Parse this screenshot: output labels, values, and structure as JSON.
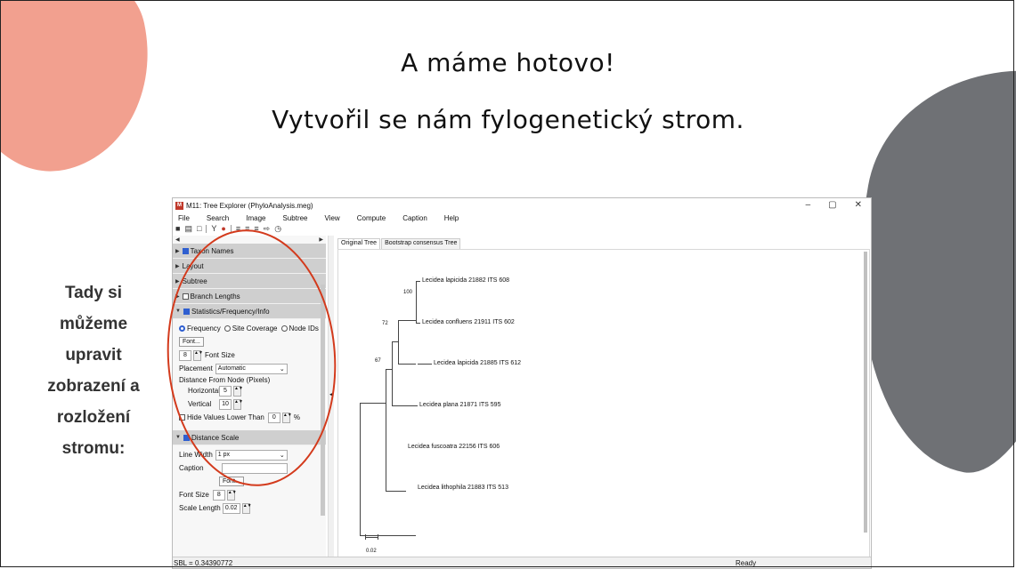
{
  "slide": {
    "title_line1": "A máme hotovo!",
    "title_line2": "Vytvořil se nám fylogenetický strom.",
    "side_lines": [
      "Tady si",
      "můžeme",
      "upravit",
      "zobrazení a",
      "rozložení",
      "stromu:"
    ]
  },
  "window": {
    "title": "M11: Tree Explorer (PhyloAnalysis.meg)",
    "icon_text": "M",
    "controls": [
      "–",
      "▢",
      "✕"
    ],
    "menu": [
      "File",
      "Search",
      "Image",
      "Subtree",
      "View",
      "Compute",
      "Caption",
      "Help"
    ],
    "toolbar_icons": [
      "save-icon",
      "print-icon",
      "copy-icon",
      "filter-icon",
      "info-icon",
      "tree-layout-icon",
      "tree-layout-2-icon",
      "tree-layout-3-icon",
      "swap-icon",
      "clock-icon"
    ]
  },
  "left_panel": {
    "sections": [
      {
        "label": "Taxon Names",
        "checked": true,
        "expanded": false
      },
      {
        "label": "Layout",
        "checked": false,
        "expanded": false
      },
      {
        "label": "Subtree",
        "checked": false,
        "expanded": false
      },
      {
        "label": "Branch Lengths",
        "checked": false,
        "expanded": false
      },
      {
        "label": "Statistics/Frequency/Info",
        "checked": true,
        "expanded": true
      }
    ],
    "stats": {
      "radio_frequency": "Frequency",
      "radio_site_coverage": "Site Coverage",
      "radio_node_ids": "Node IDs",
      "font_button": "Font...",
      "font_size_value": "8",
      "font_size_label": "Font Size",
      "placement_label": "Placement",
      "placement_value": "Automatic",
      "distance_label": "Distance From Node (Pixels)",
      "horizontal_label": "Horizontal",
      "horizontal_value": "5",
      "vertical_label": "Vertical",
      "vertical_value": "10",
      "hide_label": "Hide Values Lower Than",
      "hide_value": "0",
      "hide_unit": "%"
    },
    "distance_scale": {
      "label": "Distance Scale",
      "checked": true,
      "line_width_label": "Line Width",
      "line_width_value": "1 px",
      "caption_label": "Caption",
      "font_button": "Font...",
      "font_size_label": "Font Size",
      "font_size_value": "8",
      "scale_length_label": "Scale Length",
      "scale_length_value": "0.02"
    }
  },
  "tabs": [
    "Original Tree",
    "Bootstrap consensus Tree"
  ],
  "tree": {
    "taxa": [
      "Lecidea lapicida 21882 ITS 608",
      "Lecidea confluens 21911 ITS 602",
      "Lecidea lapicida 21885 ITS 612",
      "Lecidea plana 21871 ITS 595",
      "Lecidea fuscoatra 22156 ITS 606",
      "Lecidea lithophila 21883 ITS 513"
    ],
    "bootstrap": [
      "100",
      "72",
      "67"
    ],
    "scale_label": "0.02"
  },
  "status": {
    "left": "SBL = 0.34390772",
    "right": "Ready"
  },
  "colors": {
    "pink_blob": "#f2a08f",
    "gray_blob": "#6f7175",
    "annotation_red": "#d33a1c",
    "checkbox_blue": "#2f5fd0"
  }
}
